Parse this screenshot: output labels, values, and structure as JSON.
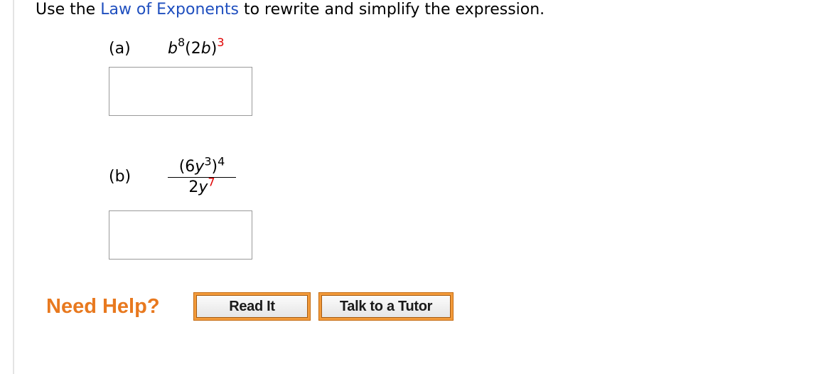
{
  "instruction": {
    "prefix": "Use the ",
    "link": "Law of Exponents",
    "suffix": " to rewrite and simplify the expression."
  },
  "part_a": {
    "label": "(a)",
    "base1": "b",
    "exp1": "8",
    "group": "(2",
    "base2": "b",
    "close": ")",
    "exp2": "3",
    "answer_value": ""
  },
  "part_b": {
    "label": "(b)",
    "num_open": "(6",
    "num_var": "y",
    "num_inner_exp": "3",
    "num_close": ")",
    "num_outer_exp": "4",
    "den_coef": "2",
    "den_var": "y",
    "den_exp": "7",
    "answer_value": ""
  },
  "help": {
    "title": "Need Help?",
    "read_it": "Read It",
    "talk_to_tutor": "Talk to a Tutor"
  },
  "colors": {
    "link": "#1f4fbf",
    "highlight_exponent": "#e00000",
    "need_help": "#e8791f",
    "button_frame": "#f29a3a"
  }
}
